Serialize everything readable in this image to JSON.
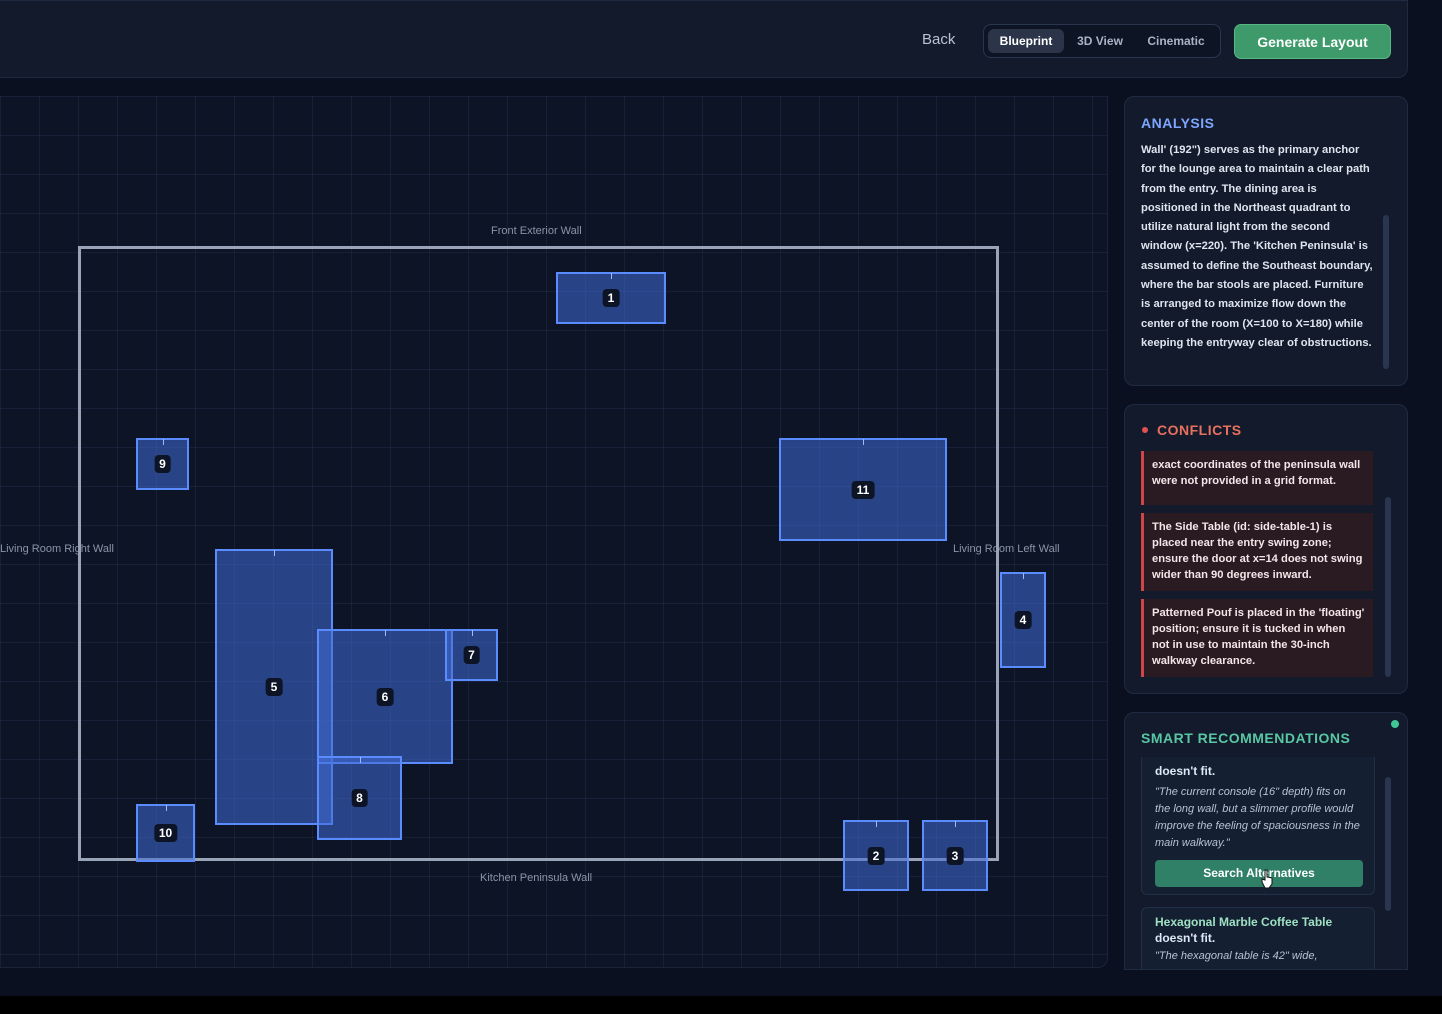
{
  "topbar": {
    "back_label": "Back",
    "view_tabs": [
      {
        "label": "Blueprint",
        "active": true
      },
      {
        "label": "3D View",
        "active": false
      },
      {
        "label": "Cinematic",
        "active": false
      }
    ],
    "generate_label": "Generate Layout"
  },
  "blueprint": {
    "walls": {
      "top": "Front Exterior Wall",
      "bottom": "Kitchen Peninsula Wall",
      "left": "Living Room Right Wall",
      "right": "Living Room Left Wall"
    },
    "pieces": [
      "1",
      "2",
      "3",
      "4",
      "5",
      "6",
      "7",
      "8",
      "9",
      "10",
      "11"
    ]
  },
  "analysis": {
    "title": "ANALYSIS",
    "text": "Wall' (192\") serves as the primary anchor for the lounge area to maintain a clear path from the entry. The dining area is positioned in the Northeast quadrant to utilize natural light from the second window (x=220). The 'Kitchen Peninsula' is assumed to define the Southeast boundary, where the bar stools are placed. Furniture is arranged to maximize flow down the center of the room (X=100 to X=180) while keeping the entryway clear of obstructions."
  },
  "conflicts": {
    "title": "CONFLICTS",
    "items": [
      "exact coordinates of the peninsula wall were not provided in a grid format.",
      "The Side Table (id: side-table-1) is placed near the entry swing zone; ensure the door at x=14 does not swing wider than 90 degrees inward.",
      "Patterned Pouf is placed in the 'floating' position; ensure it is tucked in when not in use to maintain the 30-inch walkway clearance."
    ]
  },
  "recommendations": {
    "title": "SMART RECOMMENDATIONS",
    "items": [
      {
        "title": "doesn't fit.",
        "quote": "\"The current console (16\" depth) fits on the long wall, but a slimmer profile would improve the feeling of spaciousness in the main walkway.\"",
        "button": "Search Alternatives"
      },
      {
        "title": "Hexagonal Marble Coffee Table",
        "subtitle": "doesn't fit.",
        "quote": "\"The hexagonal table is 42\" wide,"
      }
    ]
  },
  "colors": {
    "accent_blue": "#5b8cff",
    "conflict_red": "#e05252",
    "recommend_green": "#4fbf9a",
    "generate_green": "#3e9a6a"
  }
}
